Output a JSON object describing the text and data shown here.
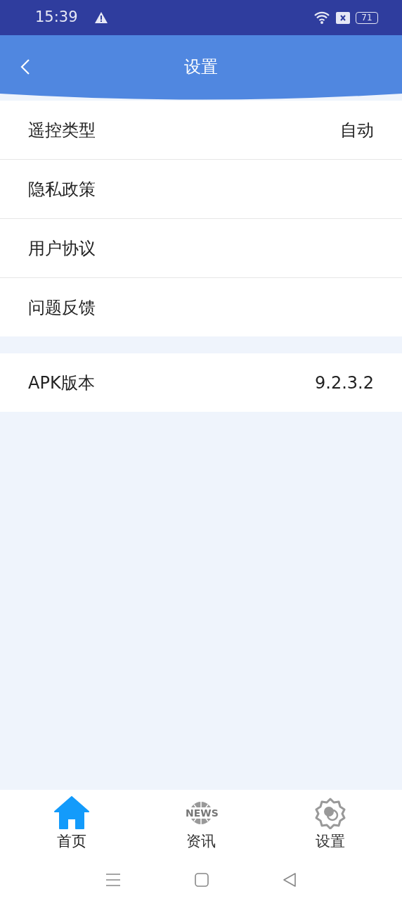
{
  "status_bar": {
    "time": "15:39",
    "battery": "71"
  },
  "header": {
    "title": "设置"
  },
  "settings": [
    {
      "label": "遥控类型",
      "value": "自动"
    },
    {
      "label": "隐私政策"
    },
    {
      "label": "用户协议"
    },
    {
      "label": "问题反馈"
    }
  ],
  "version": {
    "label": "APK版本",
    "value": "9.2.3.2"
  },
  "bottom_nav": [
    {
      "kind": "home",
      "label": "首页",
      "selected": true
    },
    {
      "kind": "news",
      "label": "资讯",
      "icon_text": "NEWS",
      "selected": false
    },
    {
      "kind": "settings",
      "label": "设置",
      "selected": false
    }
  ]
}
